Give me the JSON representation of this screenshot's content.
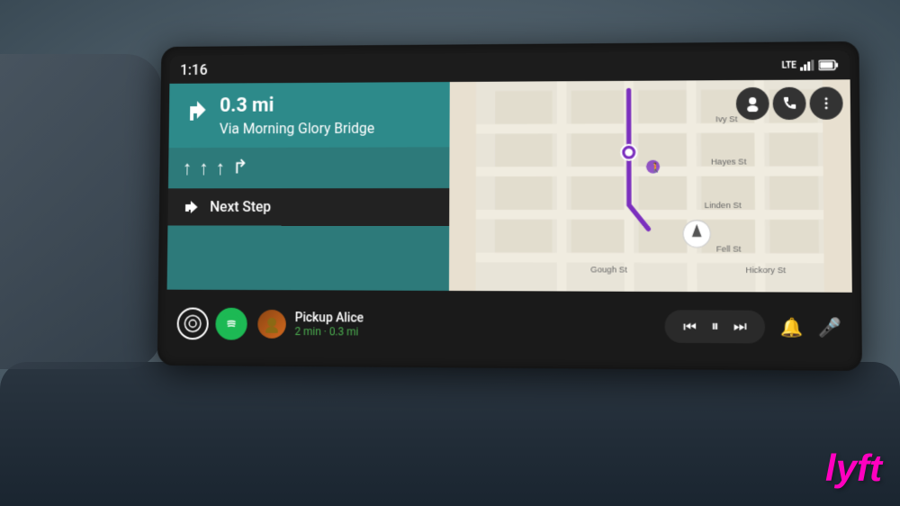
{
  "screen": {
    "time": "1:16",
    "status": {
      "lte": "LTE",
      "signal_icon": "📶",
      "battery_icon": "🔋"
    }
  },
  "navigation": {
    "distance": "0.3 mi",
    "via": "Via Morning Glory Bridge",
    "next_step_label": "Next Step",
    "direction_arrow": "↱",
    "next_step_arrow": "↱",
    "lanes": [
      "↑",
      "↑",
      "↑",
      "↱"
    ]
  },
  "map": {
    "streets": [
      "Ivy St",
      "Hayes St",
      "Linden St",
      "Fell St",
      "Gough St",
      "Hickory St"
    ],
    "buttons": [
      "person",
      "phone",
      "more"
    ]
  },
  "bottom_bar": {
    "pickup_name": "Pickup Alice",
    "pickup_distance": "2 min · 0.3 mi",
    "avatar_emoji": "👤",
    "media_controls": {
      "prev": "⏮",
      "pause": "⏸",
      "next": "⏭"
    }
  },
  "lyft": {
    "logo_text": "lyft"
  },
  "colors": {
    "nav_bg": "#2d8a8a",
    "nav_dark": "#1e6666",
    "map_bg": "#e8e0d0",
    "screen_bg": "#1c1c1c",
    "spotify_green": "#1DB954",
    "lyft_pink": "#FF00BF"
  }
}
